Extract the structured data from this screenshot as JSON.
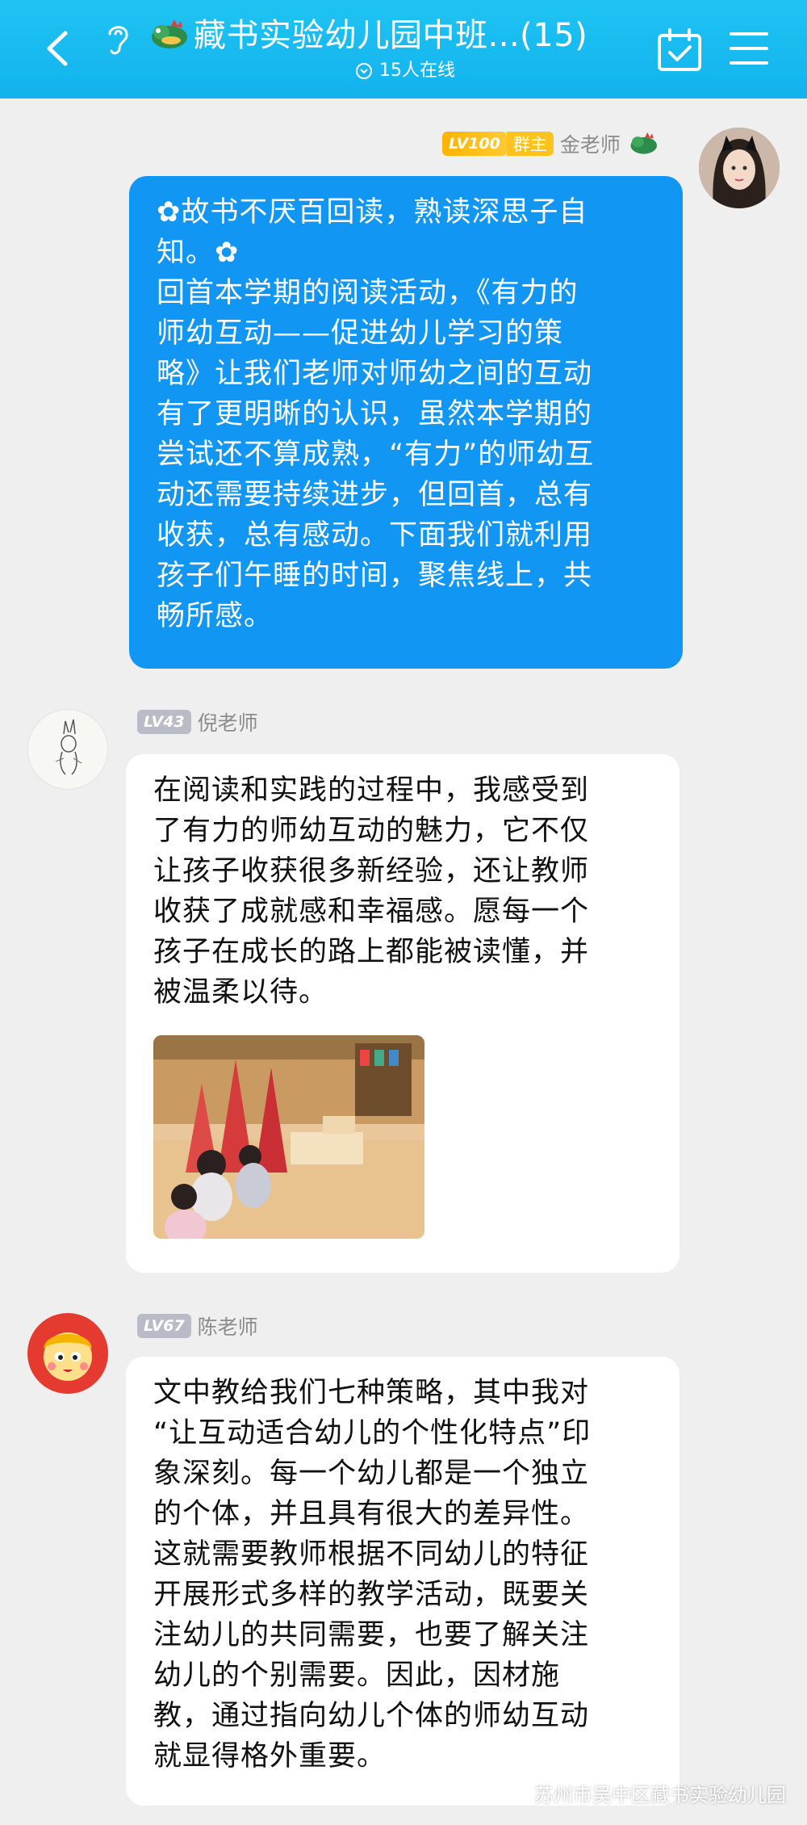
{
  "header": {
    "title": "藏书实验幼儿园中班...(15)",
    "online": "15人在线"
  },
  "messages": [
    {
      "sender": "金老师",
      "level": "LV100",
      "role": "群主",
      "side": "right",
      "lines": [
        "✿故书不厌百回读，熟读深思子自",
        "知。✿",
        "回首本学期的阅读活动，《有力的",
        "师幼互动——促进幼儿学习的策",
        "略》让我们老师对师幼之间的互动",
        "有了更明晰的认识，虽然本学期的",
        "尝试还不算成熟，“有力”的师幼互",
        "动还需要持续进步，但回首，总有",
        "收获，总有感动。下面我们就利用",
        "孩子们午睡的时间，聚焦线上，共",
        "畅所感。"
      ]
    },
    {
      "sender": "倪老师",
      "level": "LV43",
      "side": "left",
      "lines": [
        "在阅读和实践的过程中，我感受到",
        "了有力的师幼互动的魅力，它不仅",
        "让孩子收获很多新经验，还让教师",
        "收获了成就感和幸福感。愿每一个",
        "孩子在成长的路上都能被读懂，并",
        "被温柔以待。"
      ]
    },
    {
      "sender": "陈老师",
      "level": "LV67",
      "side": "left",
      "lines": [
        "文中教给我们七种策略，其中我对",
        "“让互动适合幼儿的个性化特点”印",
        "象深刻。每一个幼儿都是一个独立",
        "的个体，并且具有很大的差异性。",
        "这就需要教师根据不同幼儿的特征",
        "开展形式多样的教学活动，既要关",
        "注幼儿的共同需要，也要了解关注",
        "幼儿的个别需要。因此，因材施",
        "教，通过指向幼儿个体的师幼互动",
        "就显得格外重要。"
      ]
    }
  ],
  "watermark": "苏州市吴中区藏书实验幼儿园",
  "colors": {
    "header": "#12b3ee",
    "bubble_self": "#1296f3",
    "background": "#efefef"
  }
}
